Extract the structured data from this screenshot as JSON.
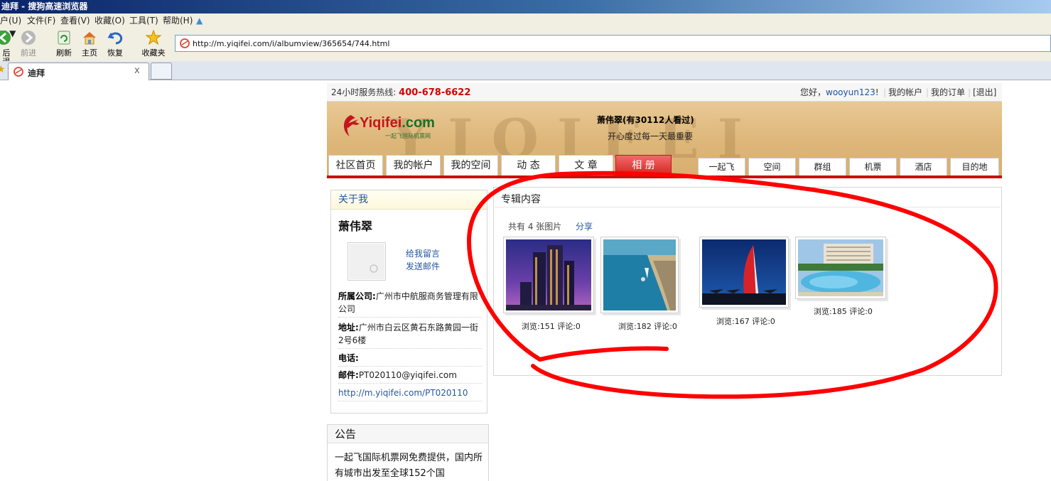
{
  "window": {
    "title": "迪拜 - 搜狗高速浏览器"
  },
  "menu": [
    "户(U)",
    "文件(F)",
    "查看(V)",
    "收藏(O)",
    "工具(T)",
    "帮助(H)"
  ],
  "toolbar": {
    "back": "后退",
    "forward": "前进",
    "refresh": "刷新",
    "home": "主页",
    "restore": "恢复",
    "favorites": "收藏夹"
  },
  "address": {
    "url": "http://m.yiqifei.com/i/albumview/365654/744.html"
  },
  "tab": {
    "title": "迪拜",
    "close": "x"
  },
  "site": {
    "hotline_label": "24小时服务热线:",
    "hotline": "400-678-6622",
    "greeting": "您好，",
    "username": "wooyun123",
    "greeting_end": "!",
    "my_account": "我的帐户",
    "my_orders": "我的订单",
    "logout": "[退出]",
    "logo_text_red": "Yiqifei",
    "logo_text_green": ".com",
    "logo_sub": "一起飞国际机票网",
    "sand_text": "YIQIFEI",
    "owner_title": "萧伟翠(有30112人看过)",
    "motto": "开心度过每一天最重要"
  },
  "nav_tabs": [
    "社区首页",
    "我的帐户",
    "我的空间",
    "动 态",
    "文 章",
    "相 册"
  ],
  "right_tabs": [
    "一起飞",
    "空间",
    "群组",
    "机票",
    "酒店",
    "目的地"
  ],
  "about": {
    "header": "关于我",
    "name": "萧伟翠",
    "leave_message": "给我留言",
    "send_mail": "发送邮件",
    "company_label": "所属公司:",
    "company": "广州市中航服商务管理有限公司",
    "address_label": "地址:",
    "address": "广州市白云区黄石东路黄园一街2号6楼",
    "phone_label": "电话:",
    "phone": "",
    "email_label": "邮件:",
    "email": "PT020110@yiqifei.com",
    "homepage": "http://m.yiqifei.com/PT020110"
  },
  "notice": {
    "header": "公告",
    "text": "一起飞国际机票网免费提供，国内所有城市出发至全球152个国"
  },
  "album": {
    "header": "专辑内容",
    "count": "共有 4 张图片",
    "share": "分享",
    "photos": [
      {
        "stats": "浏览:151 评论:0"
      },
      {
        "stats": "浏览:182 评论:0"
      },
      {
        "stats": "浏览:167 评论:0"
      },
      {
        "stats": "浏览:185 评论:0"
      }
    ]
  },
  "colors": {
    "accent_red": "#c8100f",
    "link_blue": "#2457a3",
    "annotation_red": "#ff0000"
  }
}
